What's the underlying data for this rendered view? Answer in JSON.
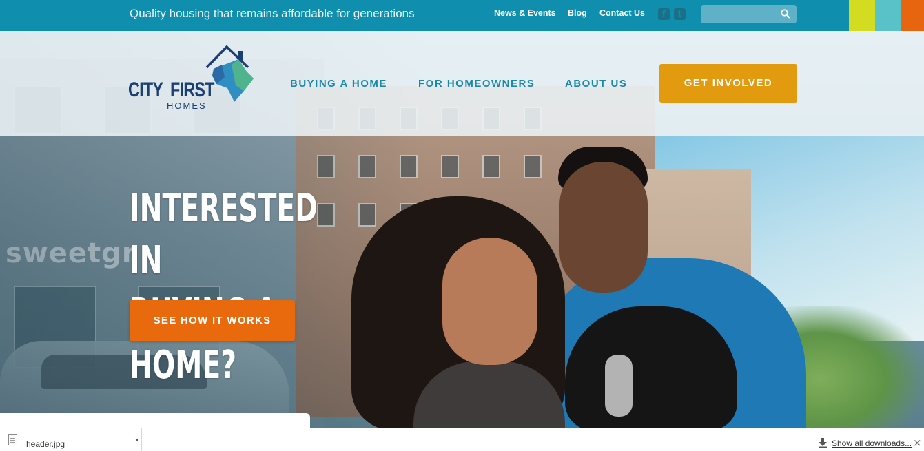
{
  "topbar": {
    "tagline": "Quality housing that remains affordable for generations",
    "links": {
      "news": "News & Events",
      "blog": "Blog",
      "contact": "Contact Us"
    },
    "social": {
      "facebook": "f",
      "twitter": "t"
    },
    "search": {
      "placeholder": "",
      "icon": "search-icon"
    },
    "swatches": [
      "#d4dc22",
      "#58c2c8",
      "#e8650f"
    ],
    "background": "#0f8fad"
  },
  "header": {
    "logo": {
      "word1": "CITY",
      "word2": "FIRST",
      "word3": "HOMES"
    },
    "nav": {
      "buying": "BUYING A HOME",
      "homeowners": "FOR HOMEOWNERS",
      "about": "ABOUT US"
    },
    "cta": "GET INVOLVED",
    "cta_color": "#e29a0e"
  },
  "hero": {
    "headline_line1": "INTERESTED IN",
    "headline_line2": "BUYING A HOME?",
    "button": "SEE HOW IT WORKS",
    "button_color": "#e86a0c",
    "background_sign": "sweetgr"
  },
  "download_bar": {
    "file_name": "header.jpg",
    "show_all": "Show all downloads...",
    "close": "×"
  }
}
